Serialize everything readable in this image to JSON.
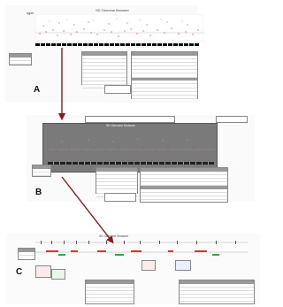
{
  "panels": {
    "a": {
      "label": "A",
      "title": "SD Genome Browser",
      "logo": "sgsb"
    },
    "b": {
      "label": "B",
      "title": "SD Genome Browser"
    },
    "c": {
      "label": "C",
      "title": "SD Genome Browser"
    }
  },
  "colors": {
    "arrow": "#8b1a1a",
    "scatter_red": "#d33",
    "scatter_green": "#3a3",
    "ideogram": "#000000"
  },
  "icons": [
    "arrow-icon"
  ]
}
